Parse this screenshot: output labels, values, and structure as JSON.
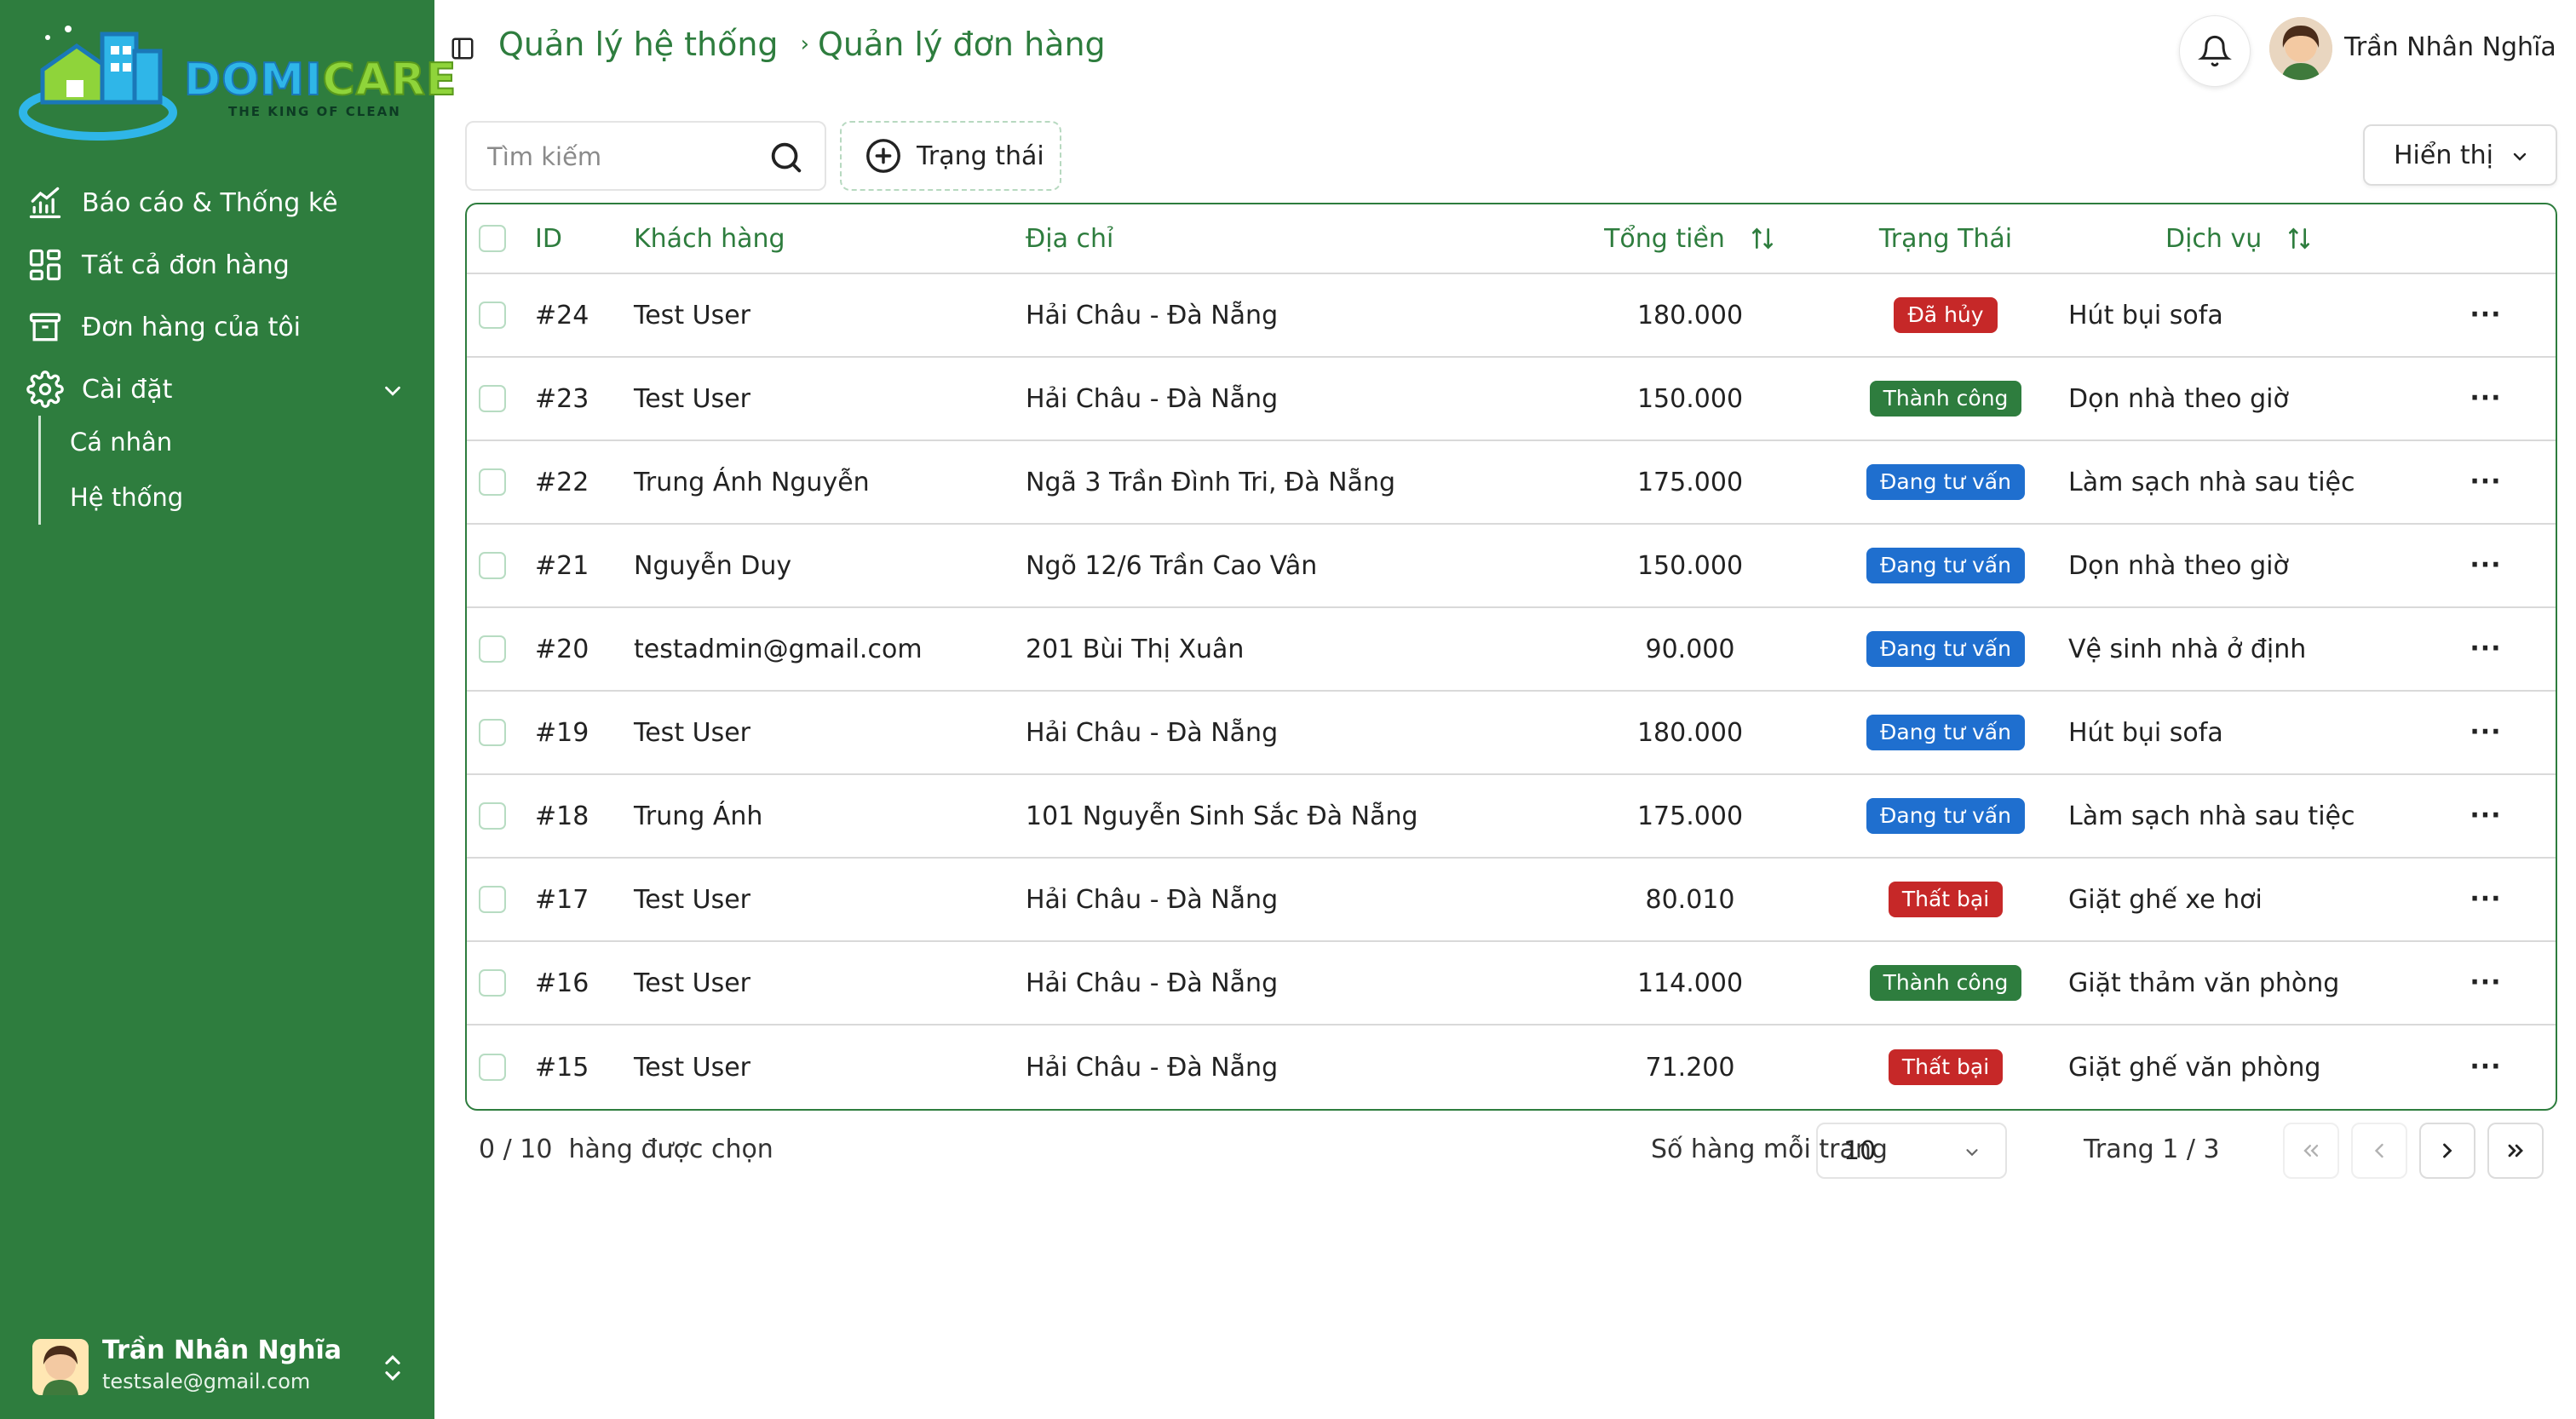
{
  "brand": {
    "name_part1": "DOMI",
    "name_part2": "CARE",
    "tagline": "THE KING OF CLEAN"
  },
  "sidebar": {
    "items": [
      {
        "label": "Báo cáo & Thống kê",
        "icon": "chart-line-icon"
      },
      {
        "label": "Tất cả đơn hàng",
        "icon": "grid-icon"
      },
      {
        "label": "Đơn hàng của tôi",
        "icon": "archive-icon"
      },
      {
        "label": "Cài đặt",
        "icon": "gear-icon"
      }
    ],
    "settings_sub": [
      {
        "label": "Cá nhân"
      },
      {
        "label": "Hệ thống"
      }
    ],
    "user": {
      "name": "Trần Nhân Nghĩa",
      "email": "testsale@gmail.com"
    }
  },
  "header": {
    "breadcrumb": [
      "Quản lý hệ thống",
      "Quản lý đơn hàng"
    ],
    "user_name": "Trần Nhân Nghĩa"
  },
  "toolbar": {
    "search_placeholder": "Tìm kiếm",
    "status_filter_label": "Trạng thái",
    "view_label": "Hiển thị"
  },
  "table": {
    "columns": {
      "id": "ID",
      "customer": "Khách hàng",
      "address": "Địa chỉ",
      "total": "Tổng tiền",
      "status": "Trạng Thái",
      "service": "Dịch vụ"
    },
    "rows": [
      {
        "id": "#24",
        "customer": "Test User",
        "address": "Hải Châu - Đà Nẵng",
        "total": "180.000",
        "status": "Đã hủy",
        "status_color": "#c62828",
        "service": "Hút bụi sofa"
      },
      {
        "id": "#23",
        "customer": "Test User",
        "address": "Hải Châu - Đà Nẵng",
        "total": "150.000",
        "status": "Thành công",
        "status_color": "#2e7d3e",
        "service": "Dọn nhà theo giờ"
      },
      {
        "id": "#22",
        "customer": "Trung Ánh Nguyễn",
        "address": "Ngã 3 Trần Đình Tri, Đà Nẵng",
        "total": "175.000",
        "status": "Đang tư vấn",
        "status_color": "#1f6fcf",
        "service": "Làm sạch nhà sau tiệc"
      },
      {
        "id": "#21",
        "customer": "Nguyễn Duy",
        "address": "Ngõ 12/6 Trần Cao Vân",
        "total": "150.000",
        "status": "Đang tư vấn",
        "status_color": "#1f6fcf",
        "service": "Dọn nhà theo giờ"
      },
      {
        "id": "#20",
        "customer": "testadmin@gmail.com",
        "address": "201 Bùi Thị Xuân",
        "total": "90.000",
        "status": "Đang tư vấn",
        "status_color": "#1f6fcf",
        "service": "Vệ sinh nhà ở định"
      },
      {
        "id": "#19",
        "customer": "Test User",
        "address": "Hải Châu - Đà Nẵng",
        "total": "180.000",
        "status": "Đang tư vấn",
        "status_color": "#1f6fcf",
        "service": "Hút bụi sofa"
      },
      {
        "id": "#18",
        "customer": "Trung Ánh",
        "address": "101 Nguyễn Sinh Sắc Đà Nẵng",
        "total": "175.000",
        "status": "Đang tư vấn",
        "status_color": "#1f6fcf",
        "service": "Làm sạch nhà sau tiệc"
      },
      {
        "id": "#17",
        "customer": "Test User",
        "address": "Hải Châu - Đà Nẵng",
        "total": "80.010",
        "status": "Thất bại",
        "status_color": "#c62828",
        "service": "Giặt ghế xe hơi"
      },
      {
        "id": "#16",
        "customer": "Test User",
        "address": "Hải Châu - Đà Nẵng",
        "total": "114.000",
        "status": "Thành công",
        "status_color": "#2e7d3e",
        "service": "Giặt thảm văn phòng"
      },
      {
        "id": "#15",
        "customer": "Test User",
        "address": "Hải Châu - Đà Nẵng",
        "total": "71.200",
        "status": "Thất bại",
        "status_color": "#c62828",
        "service": "Giặt ghế văn phòng"
      }
    ]
  },
  "footer": {
    "selected_text": "0 / 10  hàng được chọn",
    "rows_per_page_label": "Số hàng mỗi trang",
    "rows_per_page_value": "10",
    "page_text": "Trang 1 / 3"
  },
  "colors": {
    "primary": "#2e7d3e",
    "danger": "#c62828",
    "info": "#1f6fcf"
  }
}
